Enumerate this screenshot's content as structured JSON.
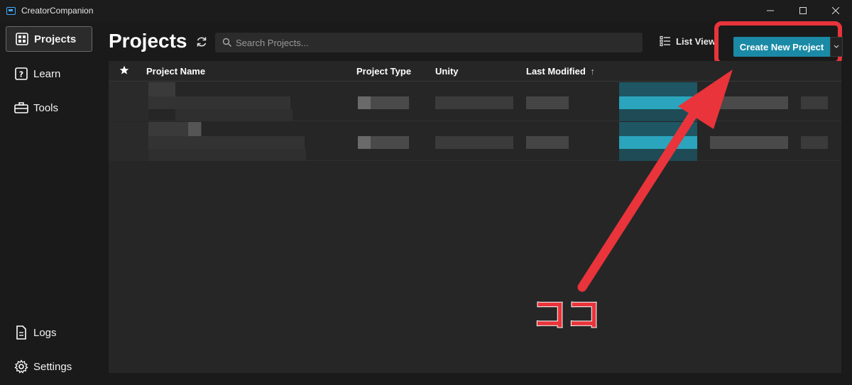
{
  "window": {
    "title": "CreatorCompanion"
  },
  "sidebar": {
    "items": [
      {
        "label": "Projects",
        "icon": "projects-grid-icon",
        "active": true
      },
      {
        "label": "Learn",
        "icon": "help-box-icon"
      },
      {
        "label": "Tools",
        "icon": "toolbox-icon"
      }
    ],
    "bottom_items": [
      {
        "label": "Logs",
        "icon": "document-icon"
      },
      {
        "label": "Settings",
        "icon": "gear-icon"
      }
    ]
  },
  "header": {
    "title": "Projects",
    "search_placeholder": "Search Projects...",
    "list_view_label": "List View",
    "create_label": "Create New Project"
  },
  "table": {
    "columns": [
      "Project Name",
      "Project Type",
      "Unity",
      "Last Modified"
    ],
    "sort_indicator": "↑"
  },
  "annotation": {
    "text": "ココ",
    "color": "#e8343a"
  },
  "colors": {
    "accent": "#1a8aa6",
    "highlight": "#e8343a"
  }
}
